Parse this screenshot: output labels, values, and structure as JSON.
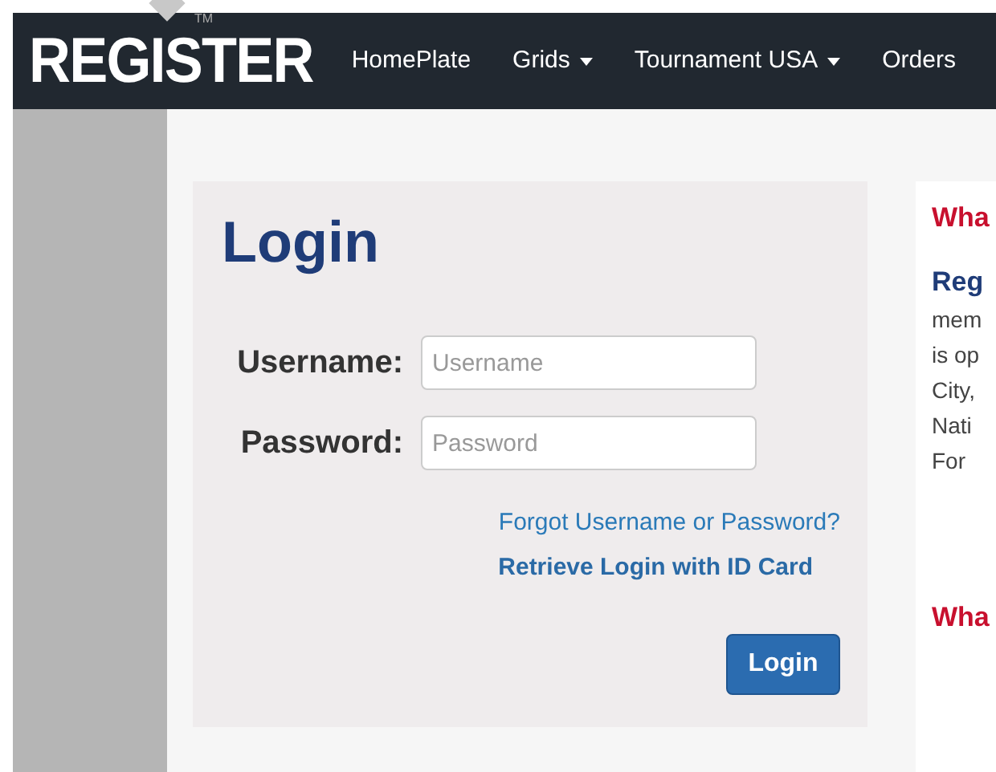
{
  "header": {
    "logo": "REGISTER",
    "trademark": "TM",
    "nav": [
      {
        "label": "HomePlate",
        "dropdown": false
      },
      {
        "label": "Grids",
        "dropdown": true
      },
      {
        "label": "Tournament USA",
        "dropdown": true
      },
      {
        "label": "Orders",
        "dropdown": false
      }
    ]
  },
  "login": {
    "title": "Login",
    "fields": [
      {
        "label": "Username:",
        "placeholder": "Username"
      },
      {
        "label": "Password:",
        "placeholder": "Password"
      }
    ],
    "links": [
      {
        "text": "Forgot Username or Password?",
        "bold": false
      },
      {
        "text": "Retrieve Login with ID Card",
        "bold": true
      }
    ],
    "button": "Login"
  },
  "side_panel": {
    "lines": [
      {
        "kind": "heading",
        "text": "Wha"
      },
      {
        "kind": "subheading",
        "text": "Reg"
      },
      {
        "kind": "body",
        "text": "mem"
      },
      {
        "kind": "body",
        "text": "is op"
      },
      {
        "kind": "body",
        "text": "City,"
      },
      {
        "kind": "body",
        "text": "Nati"
      },
      {
        "kind": "body",
        "text": "For"
      },
      {
        "kind": "gap"
      },
      {
        "kind": "heading",
        "text": "Wha"
      }
    ]
  }
}
